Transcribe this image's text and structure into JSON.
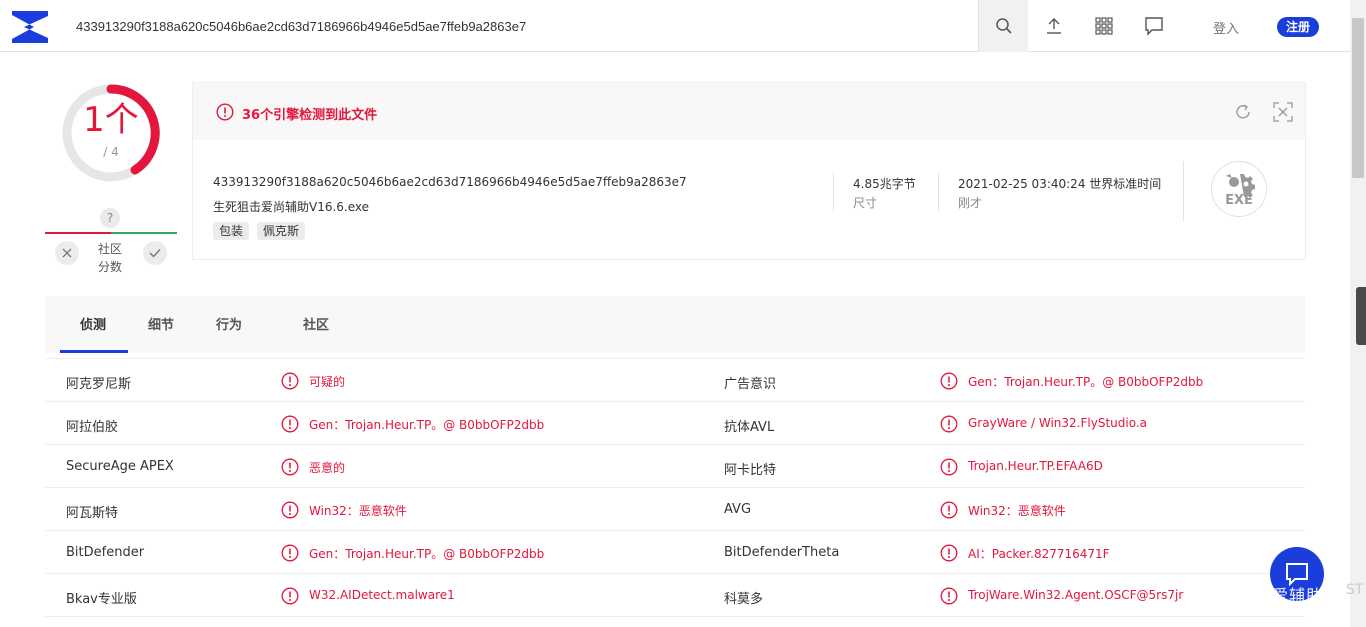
{
  "header": {
    "search_value": "433913290f3188a620c5046b6ae2cd63d7186966b4946e5d5ae7ffeb9a2863e7",
    "login_label": "登入",
    "register_label": "注册"
  },
  "score": {
    "detections": "1个",
    "total": "/ 4",
    "community_question": "?",
    "community_label_1": "社区",
    "community_label_2": "分数"
  },
  "summary": {
    "alert_text": "36个引擎检测到此文件",
    "file_hash": "433913290f3188a620c5046b6ae2cd63d7186966b4946e5d5ae7ffeb9a2863e7",
    "file_name": "生死狙击爱尚辅助V16.6.exe",
    "tags": [
      "包装",
      "佩克斯"
    ],
    "size_value": "4.85兆字节",
    "size_label": "尺寸",
    "date_value": "2021-02-25 03:40:24 世界标准时间",
    "date_label": "刚才",
    "file_type": "EXE"
  },
  "tabs": [
    "侦测",
    "细节",
    "行为",
    "社区"
  ],
  "detections": [
    {
      "left_engine": "阿克罗尼斯",
      "left_result": "可疑的",
      "right_engine": "广告意识",
      "right_result": "Gen：Trojan.Heur.TP。@ B0bbOFP2dbb"
    },
    {
      "left_engine": "阿拉伯胶",
      "left_result": "Gen：Trojan.Heur.TP。@ B0bbOFP2dbb",
      "right_engine": "抗体AVL",
      "right_result": "GrayWare / Win32.FlyStudio.a"
    },
    {
      "left_engine": "SecureAge APEX",
      "left_result": "恶意的",
      "right_engine": "阿卡比特",
      "right_result": "Trojan.Heur.TP.EFAA6D"
    },
    {
      "left_engine": "阿瓦斯特",
      "left_result": "Win32：恶意软件",
      "right_engine": "AVG",
      "right_result": "Win32：恶意软件"
    },
    {
      "left_engine": "BitDefender",
      "left_result": "Gen：Trojan.Heur.TP。@ B0bbOFP2dbb",
      "right_engine": "BitDefenderTheta",
      "right_result": "AI：Packer.827716471F"
    },
    {
      "left_engine": "Bkav专业版",
      "left_result": "W32.AIDetect.malware1",
      "right_engine": "科莫多",
      "right_result": "TrojWare.Win32.Agent.OSCF@5rs7jr"
    }
  ],
  "watermark": "爱辅助",
  "watermark_suffix": "ST",
  "colors": {
    "accent": "#1a3ddb",
    "danger": "#e3163c",
    "success": "#3aa657"
  },
  "icons": [
    "logo-icon",
    "search-icon",
    "upload-icon",
    "grid-icon",
    "chat-icon",
    "alert-icon",
    "reload-icon",
    "expand-icon",
    "exe-icon",
    "close-icon",
    "check-icon"
  ]
}
